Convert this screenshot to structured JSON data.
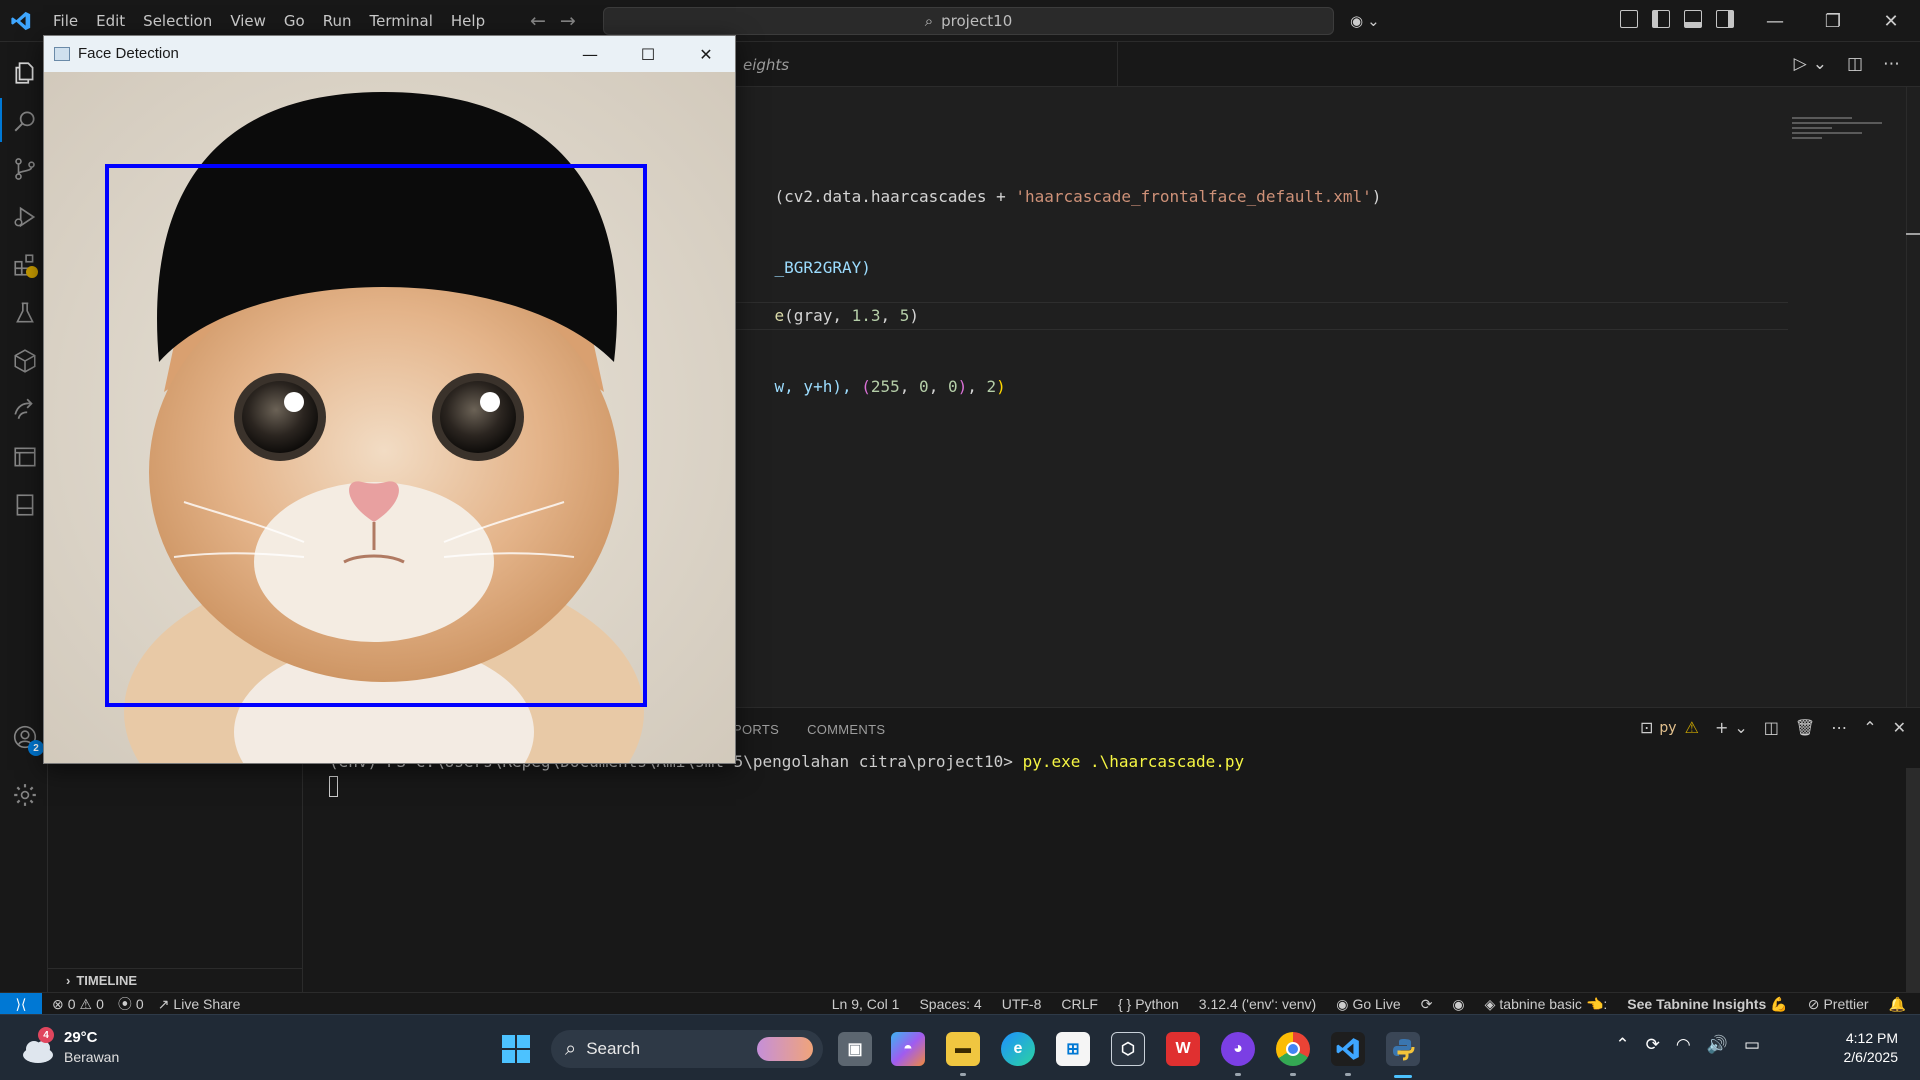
{
  "app": {
    "title": "project10",
    "menu": [
      "File",
      "Edit",
      "Selection",
      "View",
      "Go",
      "Run",
      "Terminal",
      "Help"
    ]
  },
  "editor": {
    "partial_tab": "eights",
    "code": {
      "line1_fn": "(cv2.data.haarcascades + ",
      "line1_str": "'haarcascade_frontalface_default.xml'",
      "line1_end": ")",
      "line2": "_BGR2GRAY)",
      "line3_fn": "e",
      "line3_args": "(gray, ",
      "line3_n1": "1.3",
      "line3_sep": ", ",
      "line3_n2": "5",
      "line3_end": ")",
      "line4_a": "w, y+h), ",
      "line4_tuple_open": "(",
      "line4_n1": "255",
      "line4_n2": "0",
      "line4_n3": "0",
      "line4_tuple_close": ")",
      "line4_sep": ", ",
      "line4_n4": "2",
      "line4_end": ")"
    }
  },
  "panel": {
    "tabs": [
      "PORTS",
      "COMMENTS"
    ],
    "partial_tab": "PORTS",
    "terminal_label": "py",
    "terminal_prompt": "(env) PS C:\\Users\\Repeg\\Documents\\Ami\\smt 5\\pengolahan citra\\project10> ",
    "terminal_cmd": "py.exe .\\haarcascade.py"
  },
  "sidebar": {
    "timeline_label": "TIMELINE"
  },
  "activity": {
    "accounts_badge": "2"
  },
  "statusbar": {
    "errors": "0",
    "warnings": "0",
    "ports": "0",
    "live_share": "Live Share",
    "position": "Ln 9, Col 1",
    "spaces": "Spaces: 4",
    "encoding": "UTF-8",
    "eol": "CRLF",
    "language": "Python",
    "interpreter": "3.12.4 ('env': venv)",
    "go_live": "Go Live",
    "tabnine": "tabnine basic",
    "tabnine_insights": "See Tabnine Insights",
    "prettier": "Prettier"
  },
  "face_window": {
    "title": "Face Detection"
  },
  "taskbar": {
    "weather_temp": "29°C",
    "weather_desc": "Berawan",
    "weather_badge": "4",
    "search_label": "Search",
    "time": "4:12 PM",
    "date": "2/6/2025"
  }
}
